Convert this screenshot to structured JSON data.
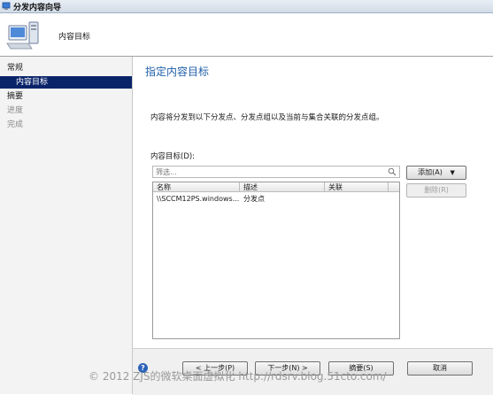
{
  "window": {
    "title": "分发内容向导"
  },
  "header": {
    "title": "内容目标"
  },
  "sidebar": {
    "items": [
      {
        "label": "常规",
        "state": "category"
      },
      {
        "label": "内容目标",
        "state": "selected"
      },
      {
        "label": "摘要",
        "state": "category"
      },
      {
        "label": "进度",
        "state": "disabled"
      },
      {
        "label": "完成",
        "state": "disabled"
      }
    ]
  },
  "main": {
    "title": "指定内容目标",
    "description": "内容将分发到以下分发点、分发点组以及当前与集合关联的分发点组。",
    "list_label": "内容目标(D):",
    "filter_placeholder": "筛选...",
    "columns": [
      "名称",
      "描述",
      "关联"
    ],
    "rows": [
      [
        "\\\\SCCM12PS.windows...",
        "分发点",
        ""
      ]
    ],
    "add_button": "添加(A)",
    "remove_button": "删除(R)"
  },
  "footer": {
    "prev_button": "< 上一步(P)",
    "next_button": "下一步(N) >",
    "summary_button": "摘要(S)",
    "cancel_button": "取消"
  },
  "watermark": "© 2012 ZJS的微软桌面虚拟化 http://rdsrv.blog.51cto.com/"
}
